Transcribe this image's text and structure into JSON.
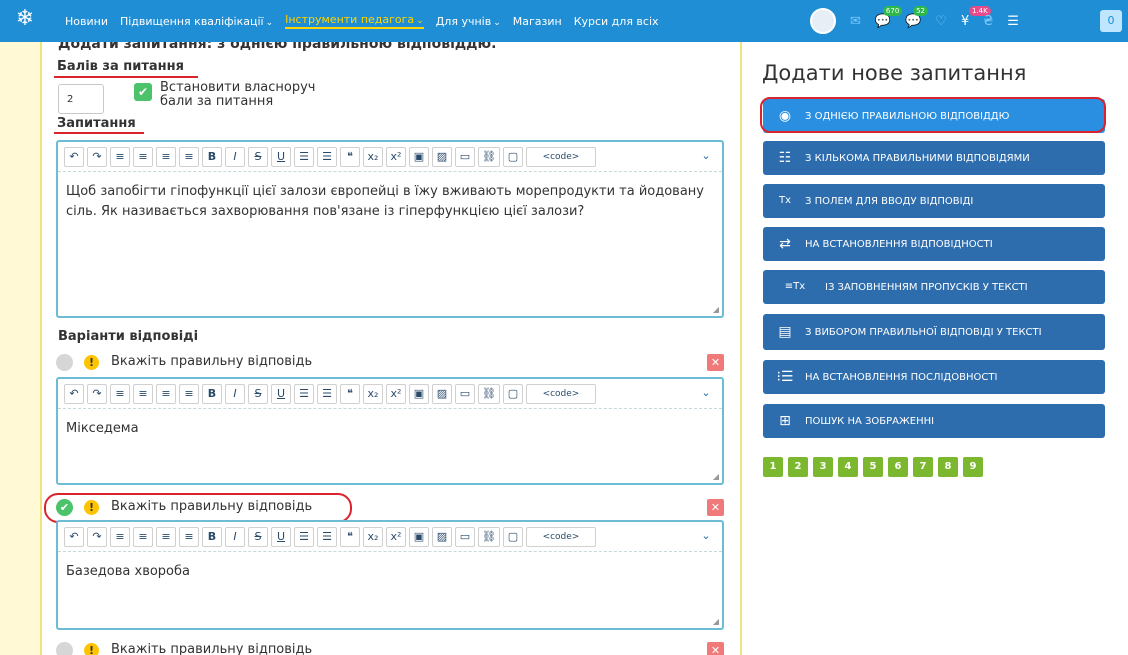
{
  "nav": {
    "items": [
      {
        "label": "Новини",
        "has_menu": false,
        "active": false
      },
      {
        "label": "Підвищення кваліфікації",
        "has_menu": true,
        "active": false
      },
      {
        "label": "Інструменти педагога",
        "has_menu": true,
        "active": true
      },
      {
        "label": "Для учнів",
        "has_menu": true,
        "active": false
      },
      {
        "label": "Магазин",
        "has_menu": false,
        "active": false
      },
      {
        "label": "Курси для всіх",
        "has_menu": false,
        "active": false
      }
    ],
    "chevron": "⌄",
    "badges": {
      "messages": "670",
      "notifications": "52",
      "bonus": "1.4K",
      "cart": "0"
    },
    "colors": {
      "bar": "#1f8ed4",
      "active": "#ffd400"
    }
  },
  "form": {
    "heading": "Додати запитання: з однією правильною відповіддю.",
    "points_label": "Балів за питання",
    "points_value": "2",
    "manual_points_line1": "Встановити власноруч",
    "manual_points_line2": "бали за питання",
    "question_label": "Запитання",
    "question_text": "Щоб запобігти гіпофункції цієї залози європейці в їжу вживають морепродукти та йодовану сіль. Як називається захворювання пов'язане із гіперфункцією цієї залози?",
    "answers_label": "Варіанти відповіді",
    "answer_hint": "Вкажіть правильну відповідь",
    "answers": [
      {
        "text": "Мікседема",
        "correct": false
      },
      {
        "text": "Базедова хвороба",
        "correct": true
      },
      {
        "text": "",
        "correct": false
      }
    ]
  },
  "toolbar": {
    "undo": "↶",
    "redo": "↷",
    "align_left": "≡",
    "align_center": "≡",
    "align_right": "≡",
    "justify": "≡",
    "bold": "B",
    "italic": "I",
    "strike": "S",
    "underline": "U",
    "bullets": "☰",
    "numbered": "☰",
    "quote": "❝",
    "subscript": "x₂",
    "superscript": "x²",
    "image": "▣",
    "media": "▨",
    "file": "▭",
    "link": "⛓",
    "comment": "▢",
    "code": "<code>",
    "more": "⌄"
  },
  "sidebar": {
    "title": "Додати нове запитання",
    "question_types": [
      {
        "label": "З ОДНІЄЮ ПРАВИЛЬНОЮ ВІДПОВІДДЮ",
        "icon": "◉",
        "selected": true
      },
      {
        "label": "З КІЛЬКОМА ПРАВИЛЬНИМИ ВІДПОВІДЯМИ",
        "icon": "☷",
        "selected": false
      },
      {
        "label": "З ПОЛЕМ ДЛЯ ВВОДУ ВІДПОВІДІ",
        "icon": "Tx",
        "selected": false
      },
      {
        "label": "НА ВСТАНОВЛЕННЯ ВІДПОВІДНОСТІ",
        "icon": "⇄",
        "selected": false
      },
      {
        "label": "ІЗ ЗАПОВНЕННЯМ ПРОПУСКІВ У ТЕКСТІ",
        "icon": "≡Tx",
        "selected": false
      },
      {
        "label": "З ВИБОРОМ ПРАВИЛЬНОЇ ВІДПОВІДІ У ТЕКСТІ",
        "icon": "▤",
        "selected": false
      },
      {
        "label": "НА ВСТАНОВЛЕННЯ ПОСЛІДОВНОСТІ",
        "icon": "⁝☰",
        "selected": false
      },
      {
        "label": "ПОШУК НА ЗОБРАЖЕННІ",
        "icon": "⊞",
        "selected": false
      }
    ],
    "pages": [
      "1",
      "2",
      "3",
      "4",
      "5",
      "6",
      "7",
      "8",
      "9"
    ]
  }
}
